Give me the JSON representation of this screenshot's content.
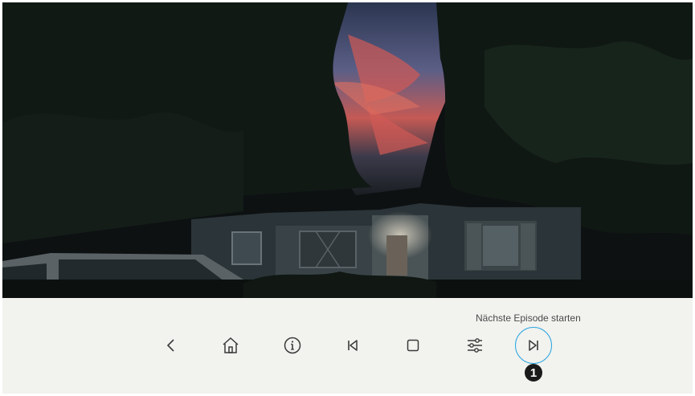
{
  "player": {
    "next_episode_tooltip": "Nächste Episode starten",
    "step_marker": "1",
    "accent_color": "#2aa6e0",
    "controls": [
      {
        "name": "back-button",
        "icon": "chevron-left-icon"
      },
      {
        "name": "home-button",
        "icon": "home-icon"
      },
      {
        "name": "info-button",
        "icon": "info-icon"
      },
      {
        "name": "previous-button",
        "icon": "skip-previous-icon"
      },
      {
        "name": "stop-button",
        "icon": "stop-square-icon"
      },
      {
        "name": "settings-button",
        "icon": "sliders-icon"
      },
      {
        "name": "next-episode-button",
        "icon": "skip-next-icon",
        "focused": true
      }
    ]
  }
}
